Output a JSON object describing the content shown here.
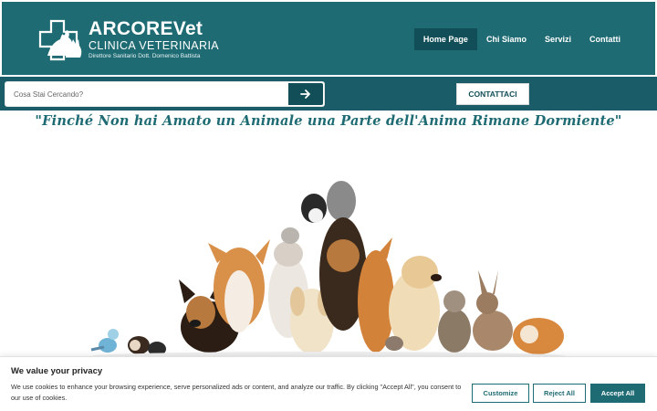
{
  "header": {
    "logo": {
      "title": "ARCOREVet",
      "subtitle": "CLINICA VETERINARIA",
      "director": "Direttore Sanitario Dott. Domenico Battista",
      "icon": "vet-cross-dog-cat-logo"
    },
    "nav": [
      {
        "label": "Home Page",
        "active": true
      },
      {
        "label": "Chi Siamo",
        "active": false
      },
      {
        "label": "Servizi",
        "active": false
      },
      {
        "label": "Contatti",
        "active": false
      }
    ]
  },
  "search": {
    "placeholder": "Cosa Stai Cercando?",
    "value": "",
    "button_icon": "arrow-right-icon"
  },
  "contact_button": "CONTATTACI",
  "quote": "\"Finché Non hai Amato un Animale una Parte dell'Anima Rimane Dormiente\"",
  "hero_image": "group-of-pets-icon",
  "cookie_banner": {
    "title": "We value your privacy",
    "text": "We use cookies to enhance your browsing experience, serve personalized ads or content, and analyze our traffic. By clicking \"Accept All\", you consent to our use of cookies.",
    "customize": "Customize",
    "reject": "Reject All",
    "accept": "Accept All"
  },
  "colors": {
    "brand": "#1f6b74",
    "brand_dark": "#124e57",
    "bar": "#1a5d69"
  }
}
